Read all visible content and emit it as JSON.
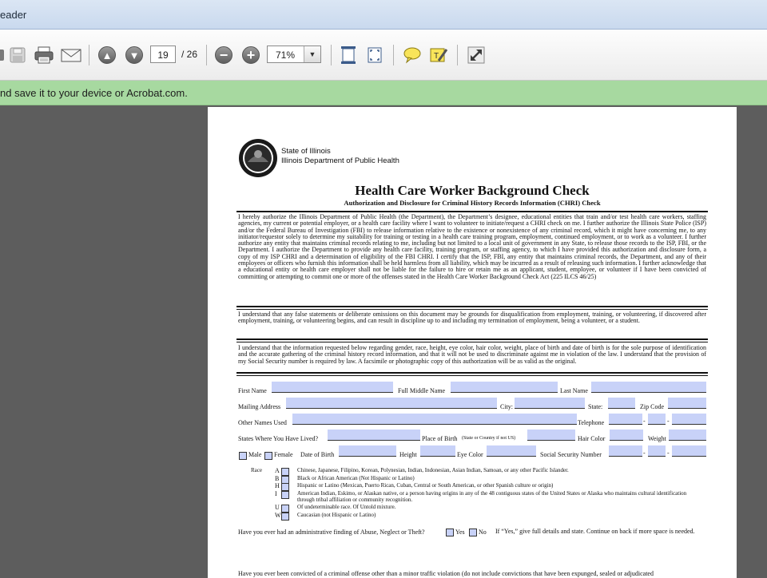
{
  "window": {
    "title": "eader"
  },
  "toolbar": {
    "page_current": "19",
    "page_total": "/ 26",
    "zoom": "71%"
  },
  "banner": {
    "text": "nd save it to your device or Acrobat.com."
  },
  "doc": {
    "agency_line1": "State of Illinois",
    "agency_line2": "Illinois Department of Public Health",
    "title": "Health Care Worker Background Check",
    "subtitle": "Authorization and Disclosure for Criminal History Records Information (CHRI) Check",
    "para1": "I hereby authorize the Illinois Department of Public Health (the Department), the Department’s designee, educational entities that train and/or test health care workers, staffing agencies, my current or potential employer, or a health care facility where I want to volunteer to initiate/request a CHRI check on me. I further authorize the Illinois State Police (ISP) and/or the Federal Bureau of Investigation (FBI) to release information relative to the existence or nonexistence of any criminal record, which it might have concerning me, to any initiator/requestor solely to determine my suitability for training or testing in a health care training program, employment, continued employment, or to work as a volunteer. I further authorize any entity that maintains criminal records relating to me, including but not limited to a local unit of government in any State, to release those records to the ISP, FBI, or the Department. I authorize the Department to provide any health care facility, training program, or staffing agency, to which I have provided this authorization and disclosure form, a copy of my ISP CHRI and a determination of eligibility of the FBI CHRI. I certify that the ISP, FBI, any entity that maintains criminal records, the Department, and any of their employees or officers who furnish this information shall be held harmless from all liability, which may be incurred as a result of releasing such information. I further acknowledge that a educational entity or health care employer shall not be liable for the failure to hire or retain me as an applicant, student, employee, or volunteer if I have been convicted of committing or attempting to commit one or more of the offenses stated in the Health Care Worker Background Check Act (225 ILCS 46/25)",
    "para2": "I understand that any false statements or deliberate omissions on this document may be grounds for disqualification from employment, training, or volunteering, if discovered after employment, training, or volunteering begins, and can result in discipline up to and including my termination of employment, being a volunteer, or a student.",
    "para3": "I understand that the information requested below regarding gender, race, height, eye color, hair color, weight, place of birth and date of birth is for the sole purpose of identification and the accurate gathering of the criminal history record information, and that it will not be used to discriminate against me in violation of the law. I understand that the provision of my Social Security number is required by law. A facsimile or photographic copy of this authorization will be as valid as the original.",
    "labels": {
      "first_name": "First Name",
      "full_middle_name": "Full Middle Name",
      "last_name": "Last Name",
      "mailing_address": "Mailing Address",
      "city": "City:",
      "state": "State:",
      "zip_code": "Zip Code",
      "other_names": "Other Names Used",
      "telephone": "Telephone",
      "states_lived": "States Where You Have Lived?",
      "place_of_birth": "Place of Birth",
      "place_of_birth_note": "(State or Country if not US)",
      "hair_color": "Hair Color",
      "weight": "Weight",
      "male": "Male",
      "female": "Female",
      "date_of_birth": "Date of Birth",
      "height": "Height",
      "eye_color": "Eye Color",
      "ssn": "Social Security Number",
      "race": "Race",
      "hyphen": "-"
    },
    "race_options": [
      {
        "code": "A",
        "text": "Chinese, Japanese, Filipino, Korean, Polynesian, Indian, Indonesian, Asian Indian, Samoan, or any other Pacific Islander."
      },
      {
        "code": "B",
        "text": "Black or African American (Not Hispanic or Latino)"
      },
      {
        "code": "H",
        "text": "Hispanic or Latino (Mexican, Puerto Rican, Cuban, Central or South American, or other Spanish culture or origin)"
      },
      {
        "code": "I",
        "text": "American Indian, Eskimo, or Alaskan native, or a person having origins in any of the 48 contiguous states of the United States or Alaska who maintains cultural identification through tribal affiliation or community recognition."
      },
      {
        "code": "U",
        "text": "Of undeterminable race. Of Untold mixture."
      },
      {
        "code": "W",
        "text": "Caucasian (not Hispanic or Latino)"
      }
    ],
    "q_abuse": "Have you ever had an administrative finding of Abuse, Neglect or Theft?",
    "q_abuse_yes": "Yes",
    "q_abuse_no": "No",
    "q_abuse_if": "If “Yes,” give full details and state.  Continue on back if more space is needed.",
    "q_convicted": "Have you ever been convicted of a criminal offense other than a minor traffic violation (do not include convictions that have been expunged, sealed or adjudicated"
  }
}
